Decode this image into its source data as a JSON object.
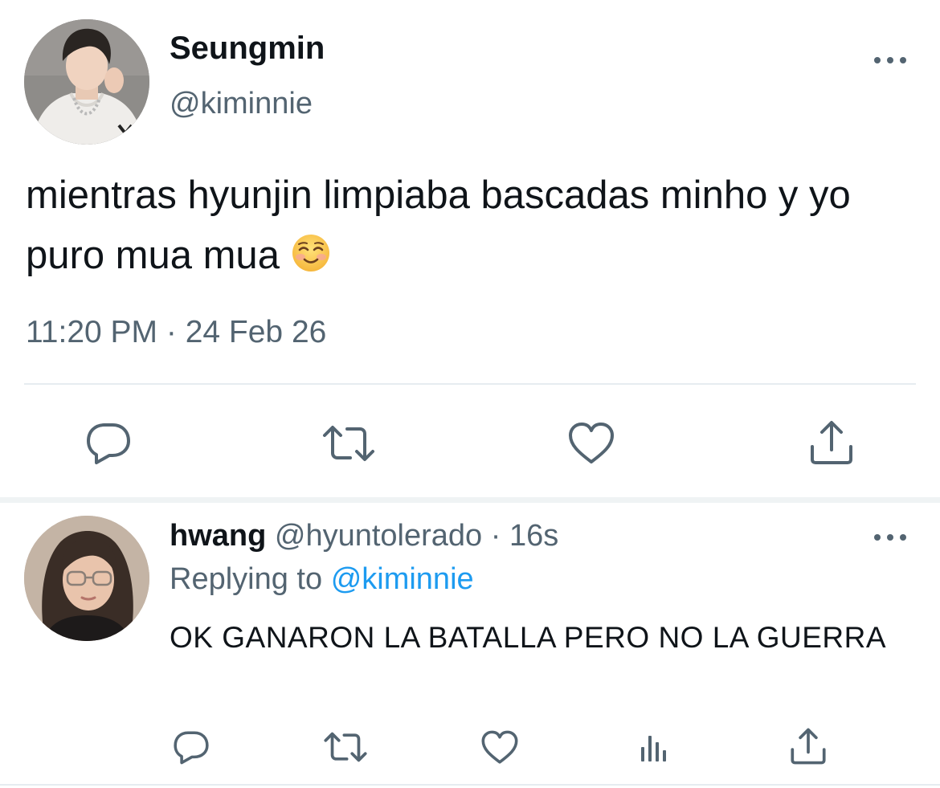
{
  "main_tweet": {
    "display_name": "Seungmin",
    "handle": "@kiminnie",
    "text": "mientras hyunjin limpiaba bascadas minho y yo puro mua mua",
    "emoji": "☺️",
    "timestamp": "11:20 PM · 24 Feb 26",
    "actions": [
      "reply-icon",
      "retweet-icon",
      "like-icon",
      "share-icon"
    ]
  },
  "reply_tweet": {
    "display_name": "hwang",
    "handle": "@hyuntolerado",
    "separator": "·",
    "time": "16s",
    "replying_label": "Replying to",
    "replying_to": "@kiminnie",
    "text": "OK GANARON LA BATALLA PERO NO LA GUERRA",
    "actions": [
      "reply-icon",
      "retweet-icon",
      "like-icon",
      "analytics-icon",
      "share-icon"
    ]
  },
  "colors": {
    "text_primary": "#0f1419",
    "text_secondary": "#536471",
    "link": "#1d9bf0",
    "divider": "#e6ecf0"
  }
}
